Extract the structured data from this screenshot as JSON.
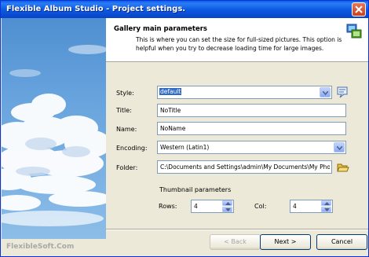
{
  "window": {
    "title": "Flexible Album Studio - Project settings."
  },
  "branding": {
    "text": "FlexibleSoft.Com"
  },
  "header": {
    "title": "Gallery main parameters",
    "description": "This is where you can set the size for full-sized pictures.  This option is helpful when you try to decrease loading time for large images."
  },
  "form": {
    "style": {
      "label": "Style:",
      "value": "default"
    },
    "title": {
      "label": "Title:",
      "value": "NoTitle"
    },
    "name": {
      "label": "Name:",
      "value": "NoName"
    },
    "encoding": {
      "label": "Encoding:",
      "value": "Western (Latin1)"
    },
    "folder": {
      "label": "Folder:",
      "value": "C:\\Documents and Settings\\admin\\My Documents\\My Photo"
    },
    "thumbnails": {
      "heading": "Thumbnail parameters",
      "rows_label": "Rows:",
      "rows_value": "4",
      "col_label": "Col:",
      "col_value": "4"
    }
  },
  "buttons": {
    "back": "< Back",
    "next": "Next >",
    "cancel": "Cancel"
  },
  "colors": {
    "titlebar": "#0b58e0",
    "dialog_bg": "#ece9d8",
    "selection": "#316ac5"
  }
}
